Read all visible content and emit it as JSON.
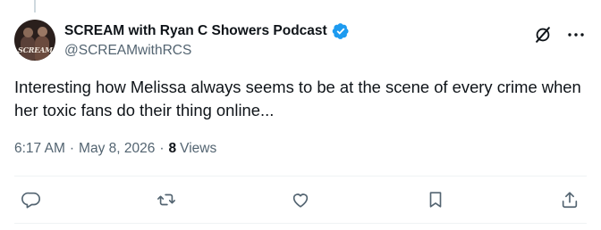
{
  "author": {
    "display_name": "SCREAM with Ryan C Showers Podcast",
    "handle": "@SCREAMwithRCS",
    "avatar_logo_text": "SCREAM",
    "verified": true
  },
  "tweet": {
    "text": "Interesting how Melissa always seems to be at the scene of every crime when her toxic fans do their thing online...",
    "time": "6:17 AM",
    "date": "May 8, 2026",
    "views_count": "8",
    "views_label": "Views"
  },
  "icons": {
    "grok": "grok-icon",
    "more": "more-icon",
    "reply": "reply-icon",
    "retweet": "retweet-icon",
    "like": "like-icon",
    "bookmark": "bookmark-icon",
    "share": "share-icon"
  },
  "colors": {
    "verified_badge": "#1d9bf0",
    "secondary_text": "#536471",
    "primary_text": "#0f1419",
    "divider": "#eff3f4"
  }
}
